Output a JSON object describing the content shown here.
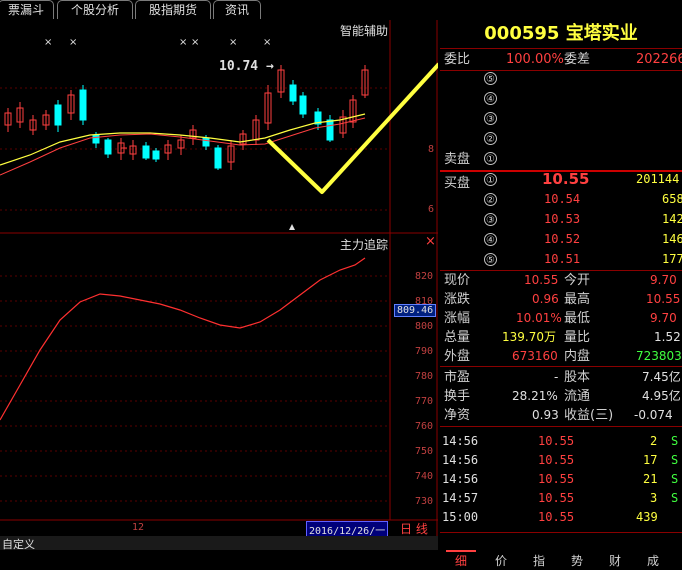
{
  "tabs": [
    "票漏斗",
    "个股分析",
    "股指期货",
    "资讯"
  ],
  "chart": {
    "top_title": "智能辅助",
    "price_annotation": "10.74 →",
    "marks": [
      "×",
      "×",
      "×",
      "×",
      "×",
      "×"
    ],
    "y_axis_top": [
      "8",
      "6"
    ],
    "indicator_title": "主力追踪",
    "indicator_close": "×",
    "indicator_axis": [
      "820",
      "810",
      "800",
      "790",
      "780",
      "770",
      "760",
      "750",
      "740",
      "730"
    ],
    "indicator_current": "809.46",
    "x_label": "12",
    "date_box": "2016/12/26/一",
    "period": "日 线",
    "custom_label": "自定义"
  },
  "quote": {
    "title": "000595 宝塔实业",
    "weibi_label": "委比",
    "weibi_value": "100.00%",
    "weicha_label": "委差",
    "weicha_value": "202266",
    "sell_label": "卖盘",
    "buy_label": "买盘",
    "sell_levels": [
      "⑤",
      "④",
      "③",
      "②",
      "①"
    ],
    "buy_levels": [
      {
        "level": "①",
        "price": "10.55",
        "vol": "201144"
      },
      {
        "level": "②",
        "price": "10.54",
        "vol": "658"
      },
      {
        "level": "③",
        "price": "10.53",
        "vol": "142"
      },
      {
        "level": "④",
        "price": "10.52",
        "vol": "146"
      },
      {
        "level": "⑤",
        "price": "10.51",
        "vol": "177"
      }
    ],
    "stats": [
      {
        "l1": "现价",
        "v1": "10.55",
        "l2": "今开",
        "v2": "9.70"
      },
      {
        "l1": "涨跌",
        "v1": "0.96",
        "l2": "最高",
        "v2": "10.55"
      },
      {
        "l1": "涨幅",
        "v1": "10.01%",
        "l2": "最低",
        "v2": "9.70"
      },
      {
        "l1": "总量",
        "v1": "139.70万",
        "l2": "量比",
        "v2": "1.52"
      },
      {
        "l1": "外盘",
        "v1": "673160",
        "l2": "内盘",
        "v2": "723803"
      }
    ],
    "finance": [
      {
        "l1": "市盈",
        "v1": "-",
        "l2": "股本",
        "v2": "7.45亿"
      },
      {
        "l1": "换手",
        "v1": "28.21%",
        "l2": "流通",
        "v2": "4.95亿"
      },
      {
        "l1": "净资",
        "v1": "0.93",
        "l2": "收益(三)",
        "v2": "-0.074"
      }
    ],
    "ticks": [
      {
        "time": "14:56",
        "price": "10.55",
        "vol": "2",
        "side": "S"
      },
      {
        "time": "14:56",
        "price": "10.55",
        "vol": "17",
        "side": "S"
      },
      {
        "time": "14:56",
        "price": "10.55",
        "vol": "21",
        "side": "S"
      },
      {
        "time": "14:57",
        "price": "10.55",
        "vol": "3",
        "side": "S"
      },
      {
        "time": "15:00",
        "price": "10.55",
        "vol": "439",
        "side": ""
      }
    ],
    "bottom_tabs": [
      "细",
      "价",
      "指",
      "势",
      "财",
      "成"
    ]
  },
  "colors": {
    "up": "#ff4040",
    "down": "#00ffff",
    "ma1": "#ffff40",
    "ma2": "#ff4040",
    "arrow": "#ffff40"
  }
}
